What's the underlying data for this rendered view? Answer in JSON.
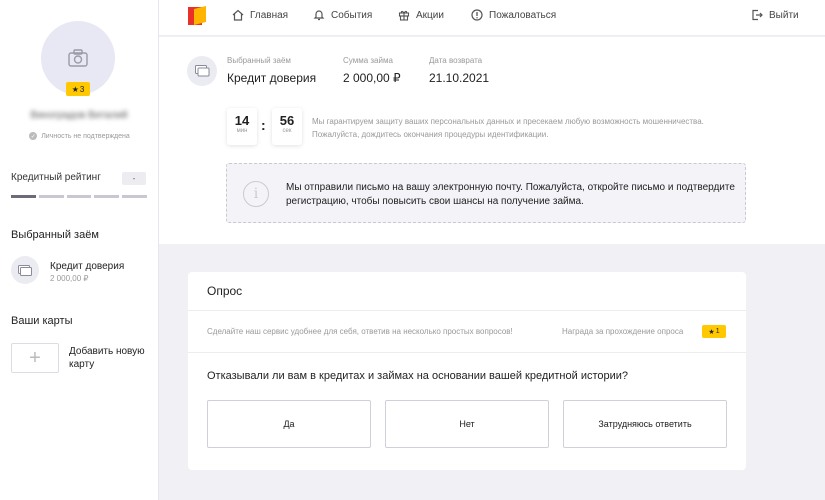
{
  "nav": {
    "home": "Главная",
    "events": "События",
    "promos": "Акции",
    "complain": "Пожаловаться",
    "logout": "Выйти"
  },
  "sidebar": {
    "avatar_badge": "3",
    "user_name": "Виноградов Виталий",
    "identity_status": "Личность не подтверждена",
    "rating_label": "Кредитный рейтинг",
    "rating_value": "-",
    "loan_title": "Выбранный заём",
    "loan_name": "Кредит доверия",
    "loan_sum": "2 000,00 ₽",
    "cards_title": "Ваши карты",
    "add_card_label": "Добавить новую карту"
  },
  "loan": {
    "chosen_label": "Выбранный заём",
    "chosen_value": "Кредит доверия",
    "sum_label": "Сумма займа",
    "sum_value": "2 000,00 ₽",
    "date_label": "Дата возврата",
    "date_value": "21.10.2021"
  },
  "timer": {
    "minutes": "14",
    "minutes_unit": "мин",
    "seconds": "56",
    "seconds_unit": "сек",
    "text": "Мы гарантируем защиту ваших персональных данных и пресекаем любую возможность мошенничества. Пожалуйста, дождитесь окончания процедуры идентификации."
  },
  "email_notice": {
    "text": "Мы отправили письмо на вашу электронную почту. Пожалуйста, откройте письмо и подтвердите регистрацию, чтобы повысить свои шансы на получение займа."
  },
  "survey": {
    "title": "Опрос",
    "intro": "Сделайте наш сервис удобнее для себя, ответив на несколько простых вопросов!",
    "reward_label": "Награда за прохождение опроса",
    "reward_value": "1",
    "question": "Отказывали ли вам в кредитах и займах на основании вашей кредитной истории?",
    "answers": [
      "Да",
      "Нет",
      "Затрудняюсь ответить"
    ]
  },
  "colors": {
    "accent": "#ffc800",
    "logo_red": "#e8312a",
    "logo_yellow": "#ffb400"
  }
}
